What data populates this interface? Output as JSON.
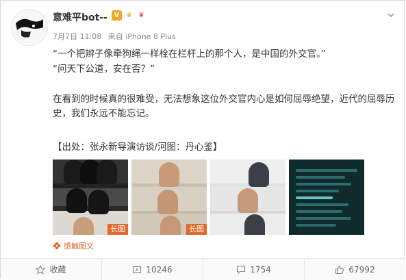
{
  "post": {
    "nickname": "意难平bot--",
    "date": "7月7日 11:08",
    "source": "来自 iPhone 8 Plus",
    "line1": "“一个把辫子像牵狗绳一样栓在栏杆上的那个人，是中国的外交官。”",
    "line2": "“问天下公道，安在否？”",
    "para": "在看到的时候真的很难受，无法想象这位外交官内心是如何屈辱绝望，近代的屈辱历史，我们永远不能忘记。",
    "source_note": "【出处：张永新导演访谈/河图：丹心鉴】",
    "image_tags": [
      "长图",
      "长图"
    ],
    "touch_label": "感触图文"
  },
  "actions": {
    "collect": "收藏",
    "repost": "10246",
    "comment": "1754",
    "like": "67992"
  },
  "icons": {
    "v_badge": "V",
    "crown": "♛",
    "gift": "❦"
  }
}
